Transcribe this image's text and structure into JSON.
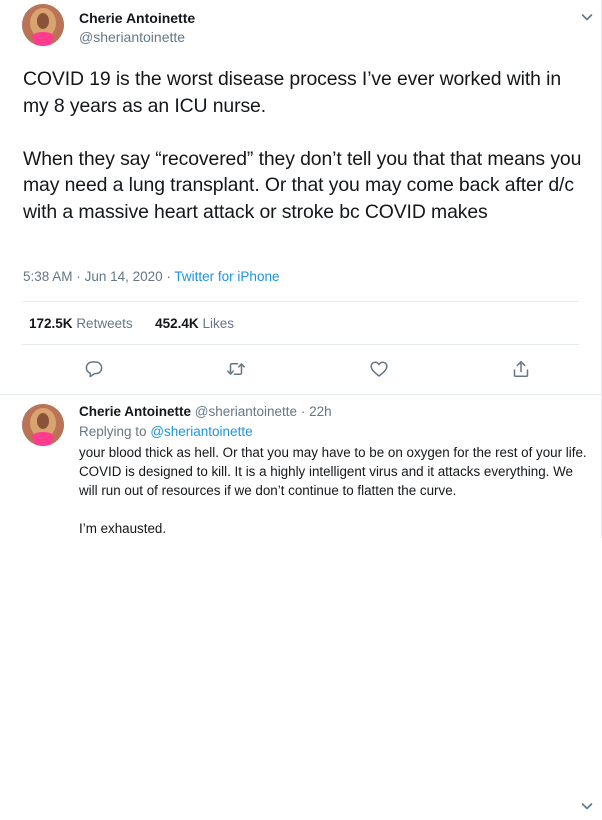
{
  "main_tweet": {
    "author_name": "Cherie Antoinette",
    "author_handle": "@sheriantoinette",
    "text": "COVID 19 is the worst disease process I’ve ever worked with in my 8 years as an ICU nurse.\n\nWhen they say “recovered” they don’t tell you that that means you may need a lung transplant. Or that you may come back after d/c with a massive heart attack or stroke bc COVID makes",
    "time": "5:38 AM",
    "separator": "·",
    "date": "Jun 14, 2020",
    "source": "Twitter for iPhone",
    "retweets_count": "172.5K",
    "retweets_label": "Retweets",
    "likes_count": "452.4K",
    "likes_label": "Likes"
  },
  "actions": {
    "reply_icon": "speech-bubble-icon",
    "retweet_icon": "retweet-arrows-icon",
    "like_icon": "heart-icon",
    "share_icon": "share-upload-icon"
  },
  "reply_tweet": {
    "author_name": "Cherie Antoinette",
    "author_handle": "@sheriantoinette",
    "separator": "·",
    "time_ago": "22h",
    "replying_to_label": "Replying to",
    "replying_to_handle": "@sheriantoinette",
    "text": "your blood thick as hell. Or that you may have to be on oxygen for the rest of your life. COVID is designed to kill. It is a highly intelligent virus and it attacks everything. We will run out of resources if we don’t continue to flatten the curve.\n\nI’m exhausted."
  },
  "colors": {
    "text": "#14171a",
    "secondary": "#657786",
    "link": "#1b95e0",
    "divider": "#e6ecf0",
    "avatar_accent": "#ff3c8e"
  }
}
